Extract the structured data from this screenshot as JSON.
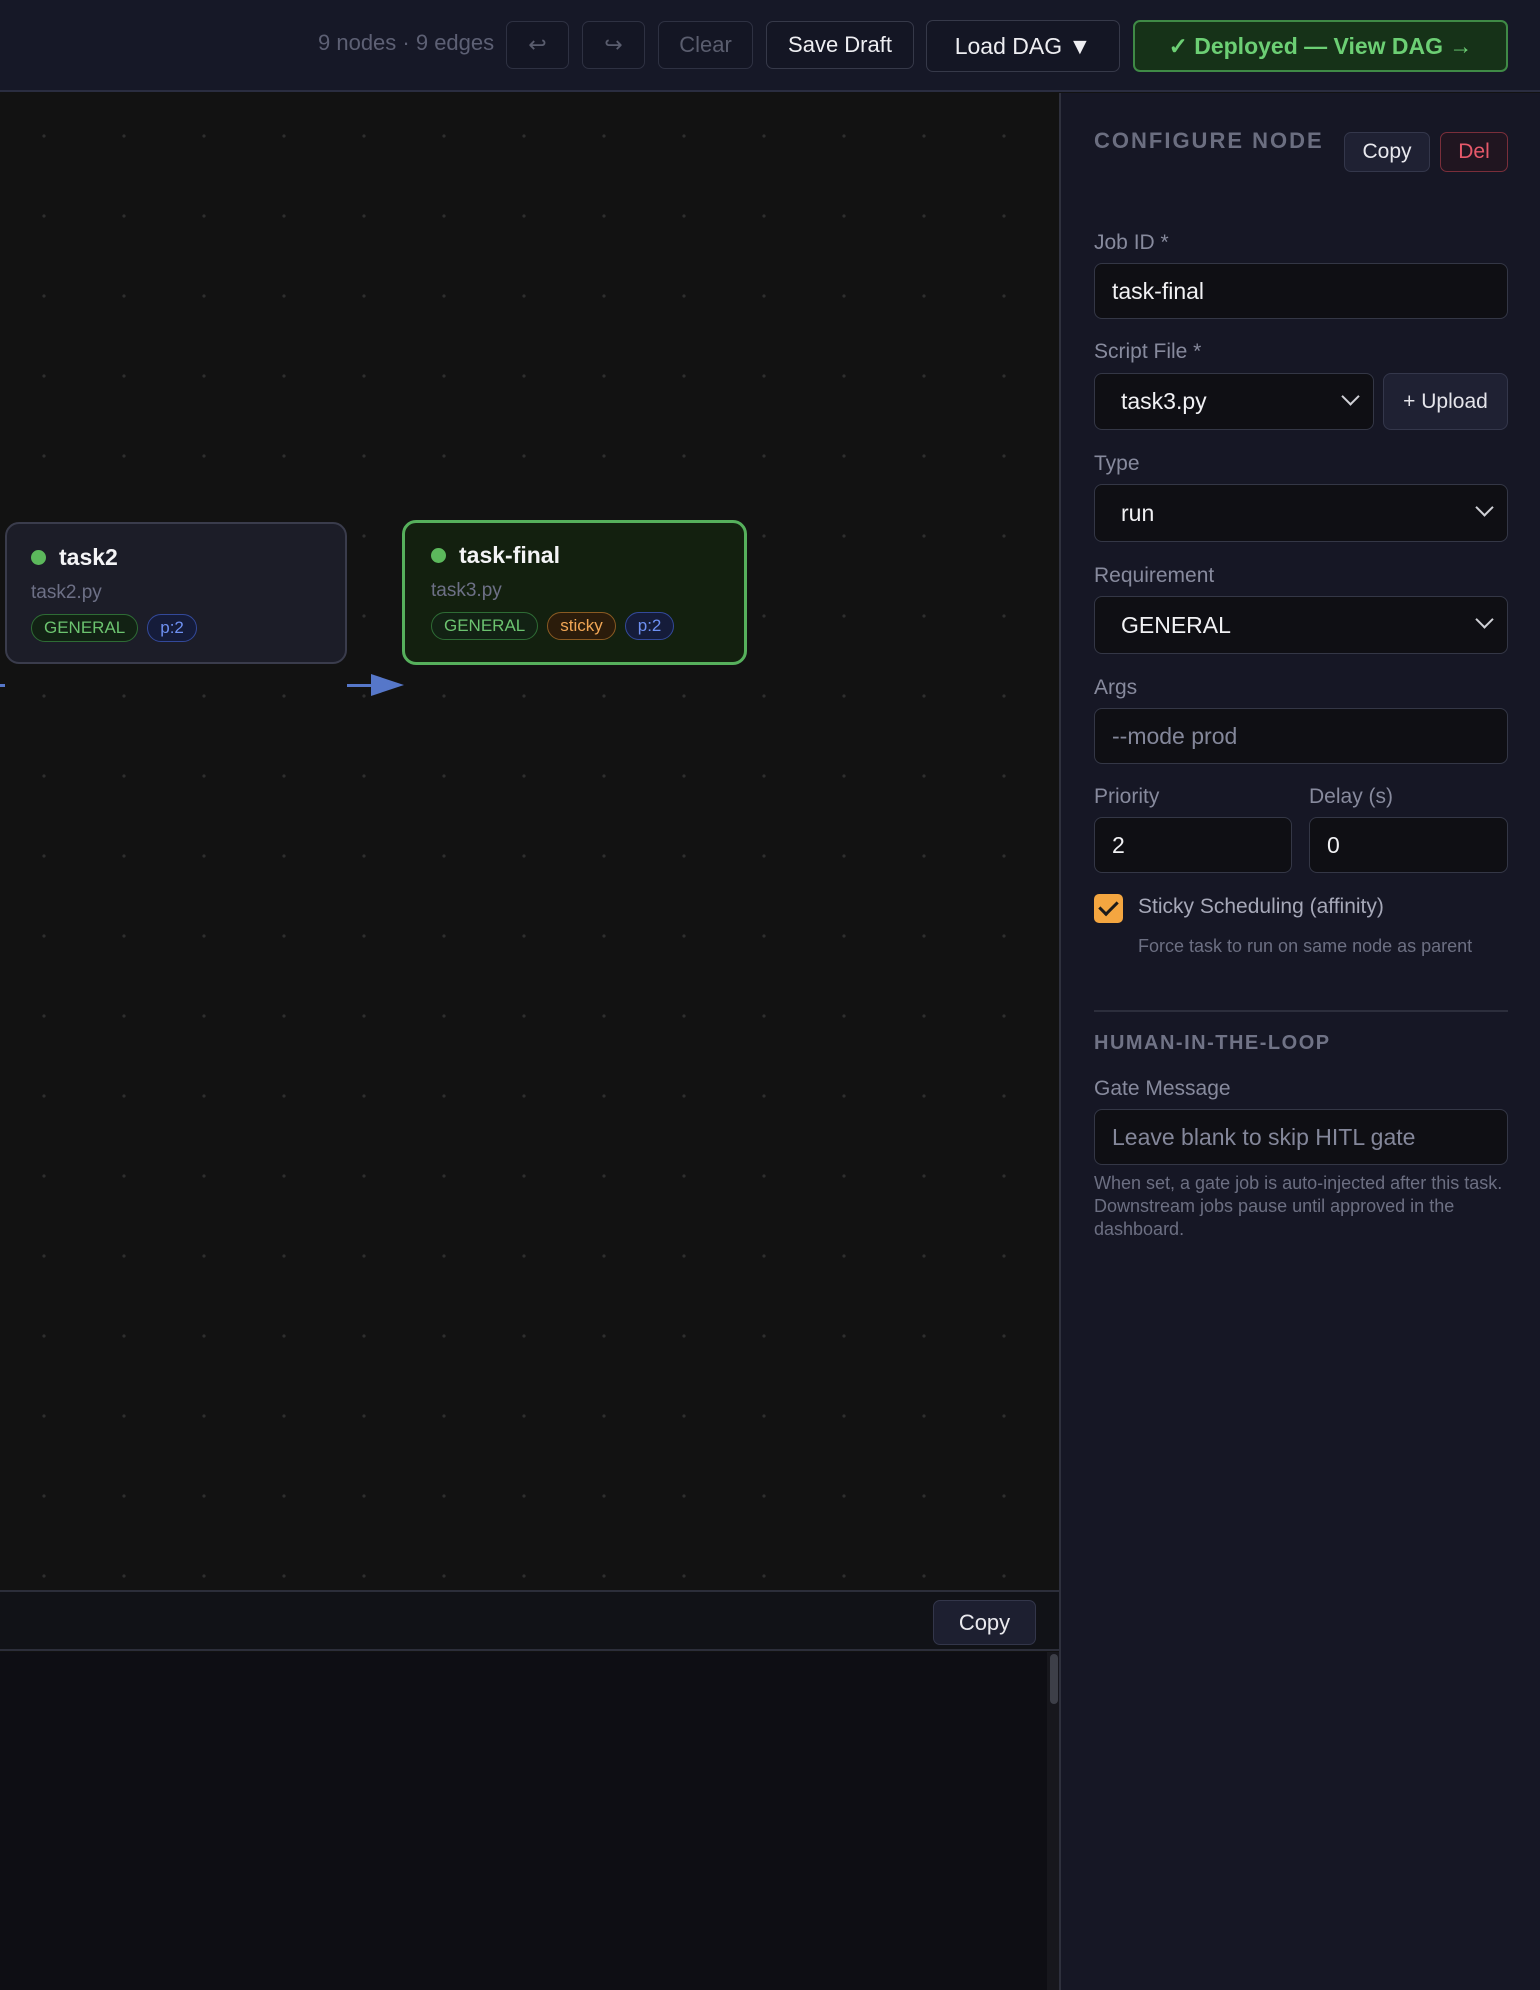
{
  "toolbar": {
    "stats": "9 nodes · 9 edges",
    "undo_icon": "↩",
    "redo_icon": "↪",
    "clear_label": "Clear",
    "save_draft_label": "Save Draft",
    "load_dag_label": "Load DAG ▼",
    "deploy_label": "✓ Deployed — View DAG →",
    "deploy_color": "#6ccf74"
  },
  "canvas": {
    "nodes": [
      {
        "name": "task2",
        "file": "task2.py",
        "tags": [
          "GENERAL",
          "p:2"
        ],
        "status_color": "#5cb85c"
      },
      {
        "name": "task-final",
        "file": "task3.py",
        "tags": [
          "GENERAL",
          "sticky",
          "p:2"
        ],
        "status_color": "#5cb85c",
        "selected": true
      }
    ]
  },
  "bottom_panel": {
    "copy_label": "Copy"
  },
  "config": {
    "title": "CONFIGURE NODE",
    "copy_label": "Copy",
    "del_label": "Del",
    "job_id": {
      "label": "Job ID *",
      "value": "task-final"
    },
    "script_file": {
      "label": "Script File *",
      "value": "task3.py",
      "upload_label": "+ Upload"
    },
    "type": {
      "label": "Type",
      "value": "run"
    },
    "requirement": {
      "label": "Requirement",
      "value": "GENERAL"
    },
    "args": {
      "label": "Args",
      "placeholder": "--mode prod"
    },
    "priority": {
      "label": "Priority",
      "value": "2"
    },
    "delay": {
      "label": "Delay (s)",
      "value": "0"
    },
    "sticky": {
      "label": "Sticky Scheduling (affinity)",
      "checked": true,
      "help": "Force task to run on same node as parent"
    },
    "hitl": {
      "section_title": "HUMAN-IN-THE-LOOP",
      "gate_label": "Gate Message",
      "gate_placeholder": "Leave blank to skip HITL gate",
      "help": "When set, a gate job is auto-injected after this task. Downstream jobs pause until approved in the dashboard."
    }
  }
}
